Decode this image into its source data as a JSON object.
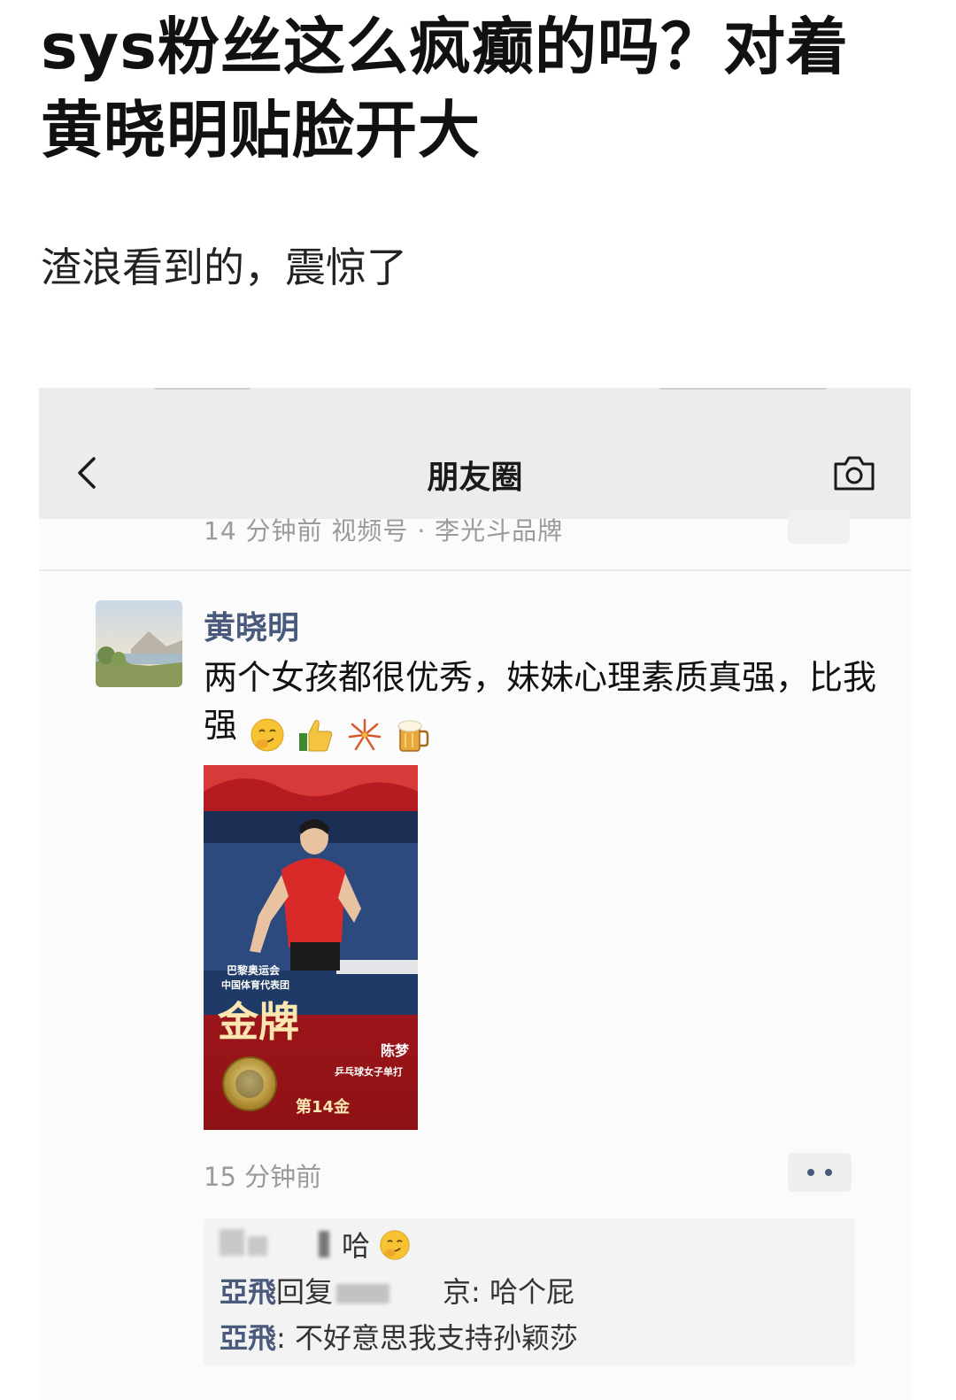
{
  "article": {
    "title": "sys粉丝这么疯癫的吗？对着黄晓明贴脸开大",
    "subtitle": "渣浪看到的，震惊了"
  },
  "screen": {
    "nav": {
      "title": "朋友圈",
      "back_icon": "chevron-left-icon",
      "camera_icon": "camera-icon"
    },
    "previous_post": {
      "meta": "14 分钟前   视频号 · 李光斗品牌"
    },
    "post": {
      "author": "黄晓明",
      "text": "两个女孩都很优秀，妹妹心理素质真强，比我强",
      "emojis": [
        "smirk-emoji",
        "thumbs-up-emoji",
        "fireworks-emoji",
        "beer-emoji"
      ],
      "image": {
        "line1": "巴黎奥运会",
        "line2": "中国体育代表团",
        "medal": "金牌",
        "athlete": "陈梦",
        "event": "乒乓球女子单打",
        "count": "第14金"
      },
      "time": "15 分钟前"
    },
    "comments": [
      {
        "text": "哈"
      },
      {
        "name": "亞飛",
        "reply_word": "回复",
        "tail": "京: 哈个屁"
      },
      {
        "name": "亞飛",
        "tail": ": 不好意思我支持孙颖莎"
      }
    ]
  }
}
